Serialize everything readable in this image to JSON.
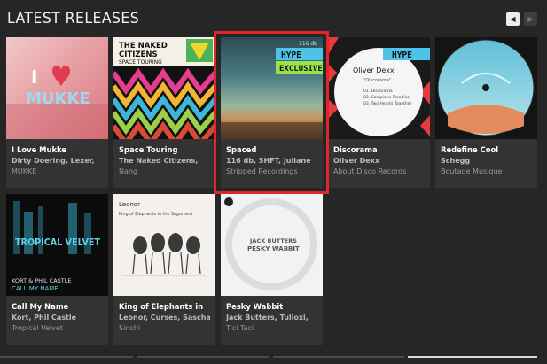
{
  "header": {
    "title": "LATEST RELEASES"
  },
  "nav": {
    "prev": "◀",
    "next": "▶"
  },
  "releases": [
    {
      "title": "I Love Mukke",
      "artists": "Dirty Doering, Lexer,",
      "label": "MUKKE"
    },
    {
      "title": "Space Touring",
      "artists": "The Naked Citizens,",
      "label": "Nang"
    },
    {
      "title": "Spaced",
      "artists": "116 db, SHFT, Juliane",
      "label": "Stripped Recordings"
    },
    {
      "title": "Discorama",
      "artists": "Oliver Dexx",
      "label": "About Disco Records"
    },
    {
      "title": "Redefine Cool",
      "artists": "Schegg",
      "label": "Boutade Musique"
    },
    {
      "title": "Call My Name",
      "artists": "Kort, Phil Castle",
      "label": "Tropical Velvet"
    },
    {
      "title": "King of Elephants in",
      "artists": "Leonor, Curses, Sascha",
      "label": "Sinchi"
    },
    {
      "title": "Pesky Wabbit",
      "artists": "Jack Butters, Tulioxi,",
      "label": "Tici Taci"
    }
  ],
  "art": {
    "mukke": {
      "logo": "MUKKE",
      "i": "I"
    },
    "naked": {
      "line1": "THE NAKED",
      "line2": "CITIZENS",
      "line3": "SPACE TOURING"
    },
    "spaced": {
      "db": "116 db",
      "hype": "HYPE",
      "exclusive": "EXCLUSIVE"
    },
    "discorama": {
      "name": "Oliver Dexx",
      "sub": "\"Discorama\"",
      "hype": "HYPE",
      "t1": "01. Discorama",
      "t2": "02. Campione Paradiso",
      "t3": "03. Two Hearts Together"
    },
    "kort": {
      "logo": "TROPICAL VELVET",
      "artists": "KORT & PHIL CASTLE",
      "track": "CALL MY NAME"
    },
    "leonor": {
      "name": "Leonor",
      "title": "King of Elephants in the Sagument"
    },
    "pesky": {
      "line1": "JACK BUTTERS",
      "line2": "PESKY WABBIT"
    }
  },
  "colors": {
    "highlight": "#e0262d",
    "hype": "#4dc3e8",
    "exclusive": "#9be34a"
  }
}
